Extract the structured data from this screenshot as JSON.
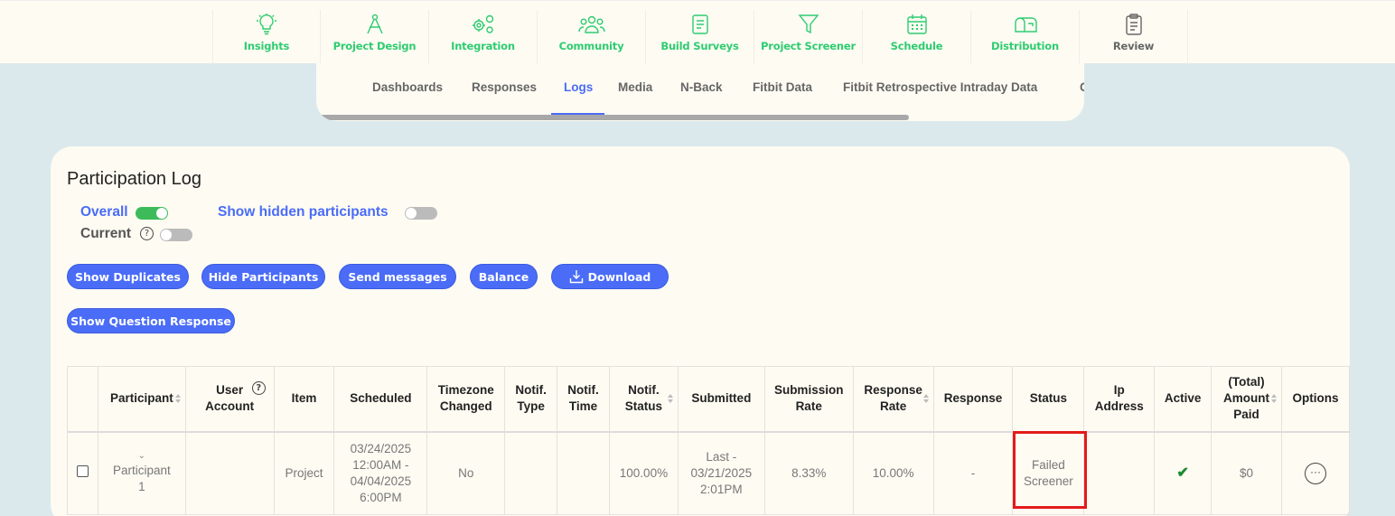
{
  "topnav": {
    "items": [
      {
        "label": "Insights",
        "icon": "lightbulb-icon",
        "color": "#2ecc71"
      },
      {
        "label": "Project Design",
        "icon": "compass-icon",
        "color": "#2ecc71"
      },
      {
        "label": "Integration",
        "icon": "gears-icon",
        "color": "#2ecc71"
      },
      {
        "label": "Community",
        "icon": "people-icon",
        "color": "#2ecc71"
      },
      {
        "label": "Build Surveys",
        "icon": "document-icon",
        "color": "#2ecc71"
      },
      {
        "label": "Project Screener",
        "icon": "filter-icon",
        "color": "#2ecc71"
      },
      {
        "label": "Schedule",
        "icon": "calendar-icon",
        "color": "#2ecc71"
      },
      {
        "label": "Distribution",
        "icon": "mailbox-icon",
        "color": "#2ecc71"
      },
      {
        "label": "Review",
        "icon": "clipboard-icon",
        "color": "#666666"
      }
    ]
  },
  "subtabs": {
    "items": [
      "Dashboards",
      "Responses",
      "Logs",
      "Media",
      "N-Back",
      "Fitbit Data",
      "Fitbit Retrospective Intraday Data",
      "C"
    ],
    "active": "Logs"
  },
  "log": {
    "title": "Participation Log",
    "overall_label": "Overall",
    "current_label": "Current",
    "current_help": "?",
    "hidden_label": "Show hidden participants",
    "buttons": {
      "show_duplicates": "Show Duplicates",
      "hide_participants": "Hide Participants",
      "send_messages": "Send messages",
      "balance": "Balance",
      "download": "Download",
      "show_question_response": "Show Question Response"
    }
  },
  "table": {
    "headers": {
      "participant": "Participant",
      "user_account_1": "User",
      "user_account_2": "Account",
      "item": "Item",
      "scheduled": "Scheduled",
      "timezone_1": "Timezone",
      "timezone_2": "Changed",
      "notif_type_1": "Notif.",
      "notif_type_2": "Type",
      "notif_time_1": "Notif.",
      "notif_time_2": "Time",
      "notif_status_1": "Notif.",
      "notif_status_2": "Status",
      "submitted": "Submitted",
      "submission_rate_1": "Submission",
      "submission_rate_2": "Rate",
      "response_rate_1": "Response",
      "response_rate_2": "Rate",
      "response": "Response",
      "status": "Status",
      "ip_1": "Ip",
      "ip_2": "Address",
      "active": "Active",
      "amount_1": "(Total)",
      "amount_2": "Amount",
      "amount_3": "Paid",
      "options": "Options"
    },
    "row": {
      "participant_1": "Participant",
      "participant_2": "1",
      "user_account": "",
      "item": "Project",
      "scheduled_1": "03/24/2025",
      "scheduled_2": "12:00AM -",
      "scheduled_3": "04/04/2025",
      "scheduled_4": "6:00PM",
      "timezone_changed": "No",
      "notif_type": "",
      "notif_time": "",
      "notif_status": "100.00%",
      "submitted_1": "Last -",
      "submitted_2": "03/21/2025",
      "submitted_3": "2:01PM",
      "submission_rate": "8.33%",
      "response_rate": "10.00%",
      "response": "-",
      "status_1": "Failed",
      "status_2": "Screener",
      "ip_address": "",
      "active": "✔",
      "amount_paid": "$0",
      "options": "···"
    }
  },
  "colors": {
    "accent": "#4a6cf7",
    "green": "#2ecc71",
    "highlight": "#e31b1b"
  }
}
